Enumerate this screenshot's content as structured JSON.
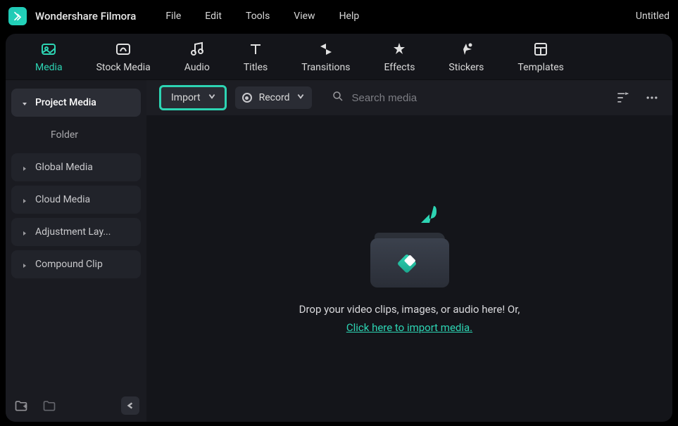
{
  "app_name": "Wondershare Filmora",
  "doc_title": "Untitled",
  "menubar": [
    "File",
    "Edit",
    "Tools",
    "View",
    "Help"
  ],
  "tabs": [
    {
      "label": "Media",
      "icon": "media"
    },
    {
      "label": "Stock Media",
      "icon": "stock"
    },
    {
      "label": "Audio",
      "icon": "audio"
    },
    {
      "label": "Titles",
      "icon": "titles"
    },
    {
      "label": "Transitions",
      "icon": "transitions"
    },
    {
      "label": "Effects",
      "icon": "effects"
    },
    {
      "label": "Stickers",
      "icon": "stickers"
    },
    {
      "label": "Templates",
      "icon": "templates"
    }
  ],
  "sidebar": {
    "project_media": "Project Media",
    "folder": "Folder",
    "items": [
      "Global Media",
      "Cloud Media",
      "Adjustment Lay...",
      "Compound Clip"
    ]
  },
  "toolbar": {
    "import_label": "Import",
    "record_label": "Record",
    "search_placeholder": "Search media"
  },
  "dropzone": {
    "line1": "Drop your video clips, images, or audio here! Or,",
    "line2": "Click here to import media."
  }
}
